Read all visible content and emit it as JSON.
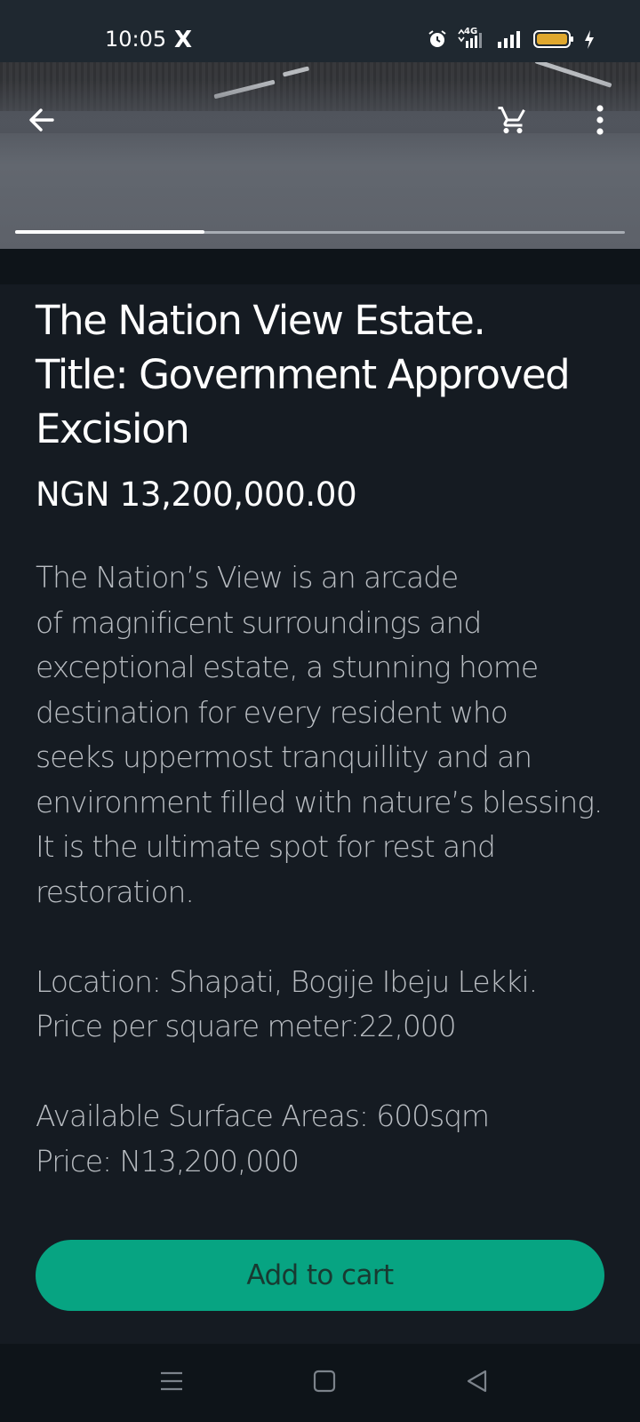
{
  "status_bar": {
    "time": "10:05",
    "notification_app": "X",
    "network_label": "4G",
    "icons": [
      "alarm-icon",
      "mobile-data-icon",
      "signal-icon",
      "battery-icon",
      "charging-icon"
    ],
    "battery_color": "#e0a82e"
  },
  "header": {
    "icons": [
      "arrow-left-icon",
      "cart-icon",
      "more-vertical-icon"
    ],
    "image_carousel_progress": 0.31
  },
  "product": {
    "title_lines": [
      "The Nation View Estate.",
      "Title: Government Approved",
      "Excision"
    ],
    "price": "NGN 13,200,000.00",
    "description_lines": [
      "The Nation’s View is an arcade",
      "of magnificent surroundings and",
      "exceptional estate, a stunning home",
      "destination for every resident who",
      "seeks uppermost tranquillity and an",
      "environment filled with nature’s blessing.",
      "It is the ultimate spot for rest and",
      "restoration.",
      "",
      "Location: Shapati, Bogije Ibeju Lekki.",
      "Price per square meter:22,000",
      "",
      "Available Surface Areas: 600sqm",
      "Price: N13,200,000"
    ]
  },
  "actions": {
    "add_to_cart_label": "Add to cart",
    "accent_color": "#07a482"
  },
  "system_nav": {
    "icons": [
      "menu-icon",
      "home-square-icon",
      "back-triangle-icon"
    ]
  }
}
